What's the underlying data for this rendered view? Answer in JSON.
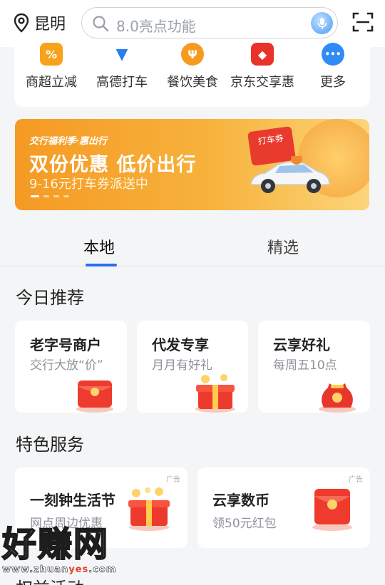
{
  "header": {
    "location": "昆明",
    "search_placeholder": "8.0亮点功能"
  },
  "shortcuts": [
    {
      "label": "商超立减",
      "icon": "percent-coupon-icon",
      "color": "#f7a21b",
      "glyph": "%"
    },
    {
      "label": "高德打车",
      "icon": "amap-taxi-icon",
      "color": "#2a7df1",
      "glyph": "▼"
    },
    {
      "label": "餐饮美食",
      "icon": "dining-icon",
      "color": "#f59a1f",
      "glyph": "Ψ"
    },
    {
      "label": "京东交享惠",
      "icon": "jd-dog-icon",
      "color": "#e8332a",
      "glyph": "◆"
    },
    {
      "label": "更多",
      "icon": "more-icon",
      "color": "#2f8bf5",
      "glyph": "•••"
    }
  ],
  "banner": {
    "tag": "交行福利季·惠出行",
    "title": "双份优惠 低价出行",
    "subtitle": "9-16元打车券派送中",
    "coupon_label": "打车券"
  },
  "tabs": [
    {
      "label": "本地",
      "active": true
    },
    {
      "label": "精选",
      "active": false
    }
  ],
  "today": {
    "title": "今日推荐",
    "cards": [
      {
        "title": "老字号商户",
        "subtitle": "交行大放“价”"
      },
      {
        "title": "代发专享",
        "subtitle": "月月有好礼"
      },
      {
        "title": "云享好礼",
        "subtitle": "每周五10点"
      }
    ]
  },
  "services": {
    "title": "特色服务",
    "cards": [
      {
        "title": "一刻钟生活节",
        "subtitle": "网点周边优惠",
        "ad": "广告"
      },
      {
        "title": "云享数币",
        "subtitle": "领50元红包",
        "ad": "广告"
      }
    ]
  },
  "next_section": "权益活动",
  "watermark": {
    "brand": "好赚网",
    "url_prefix": "www.zhuan",
    "url_highlight": "yes",
    "url_suffix": ".com"
  }
}
